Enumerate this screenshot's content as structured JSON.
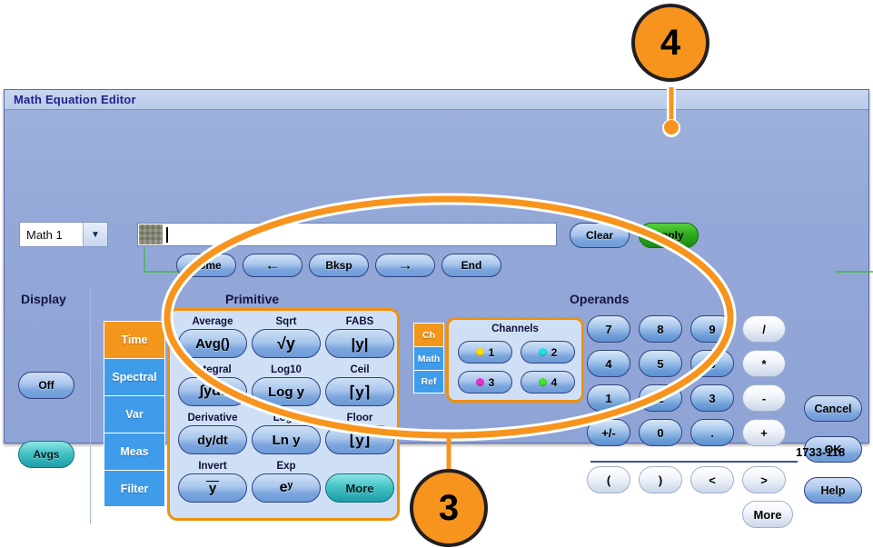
{
  "window": {
    "title": "Math Equation Editor"
  },
  "toolbar": {
    "source_select": {
      "value": "Math 1",
      "arrow_icon": "chevron-down-icon"
    },
    "equation_field": {
      "value": "",
      "placeholder": "",
      "keypad_icon": "grid-keypad-icon"
    },
    "nav_buttons": [
      {
        "label": "Home",
        "name": "home-button"
      },
      {
        "label": "←",
        "name": "left-arrow-button"
      },
      {
        "label": "Bksp",
        "name": "bksp-button"
      },
      {
        "label": "→",
        "name": "right-arrow-button"
      },
      {
        "label": "End",
        "name": "end-button"
      }
    ],
    "clear_label": "Clear",
    "apply_label": "Apply"
  },
  "display": {
    "section_label": "Display",
    "off_label": "Off",
    "avgs_label": "Avgs"
  },
  "categories": {
    "tabs": [
      {
        "label": "Time",
        "active": true
      },
      {
        "label": "Spectral",
        "active": false
      },
      {
        "label": "Var",
        "active": false
      },
      {
        "label": "Meas",
        "active": false
      },
      {
        "label": "Filter",
        "active": false
      }
    ]
  },
  "primitive": {
    "section_label": "Primitive",
    "items": [
      {
        "label": "Average",
        "symbol": "Avg()"
      },
      {
        "label": "Sqrt",
        "symbol": "√y"
      },
      {
        "label": "FABS",
        "symbol": "|y|"
      },
      {
        "label": "Integral",
        "symbol": "∫ydt"
      },
      {
        "label": "Log10",
        "symbol": "Log y"
      },
      {
        "label": "Ceil",
        "symbol": "⌈y⌉"
      },
      {
        "label": "Derivative",
        "symbol": "dy/dt"
      },
      {
        "label": "LogE",
        "symbol": "Ln y"
      },
      {
        "label": "Floor",
        "symbol": "⌊y⌋"
      },
      {
        "label": "Invert",
        "symbol": "y"
      },
      {
        "label": "Exp",
        "symbol": "eʸ"
      },
      {
        "label": "",
        "symbol": "More"
      }
    ]
  },
  "operands": {
    "section_label": "Operands",
    "source_tabs": [
      {
        "label": "Ch",
        "active": true
      },
      {
        "label": "Math",
        "active": false
      },
      {
        "label": "Ref",
        "active": false
      }
    ],
    "channels_title": "Channels",
    "channels": [
      {
        "label": "1",
        "color": "#ffe000"
      },
      {
        "label": "2",
        "color": "#20e0e8"
      },
      {
        "label": "3",
        "color": "#e830c8"
      },
      {
        "label": "4",
        "color": "#49e030"
      }
    ]
  },
  "keypad": {
    "keys": [
      {
        "label": "7",
        "style": "num"
      },
      {
        "label": "8",
        "style": "num"
      },
      {
        "label": "9",
        "style": "num"
      },
      {
        "label": "/",
        "style": "lite"
      },
      {
        "label": "4",
        "style": "num"
      },
      {
        "label": "5",
        "style": "num"
      },
      {
        "label": "6",
        "style": "num"
      },
      {
        "label": "*",
        "style": "lite"
      },
      {
        "label": "1",
        "style": "num"
      },
      {
        "label": "2",
        "style": "num"
      },
      {
        "label": "3",
        "style": "num"
      },
      {
        "label": "-",
        "style": "lite"
      },
      {
        "label": "+/-",
        "style": "num"
      },
      {
        "label": "0",
        "style": "num"
      },
      {
        "label": ".",
        "style": "num"
      },
      {
        "label": "+",
        "style": "lite"
      }
    ],
    "extra_keys": [
      {
        "label": "(",
        "style": "lite"
      },
      {
        "label": ")",
        "style": "lite"
      },
      {
        "label": "<",
        "style": "lite"
      },
      {
        "label": ">",
        "style": "lite"
      }
    ],
    "more_label": "More"
  },
  "actions": {
    "cancel_label": "Cancel",
    "ok_label": "OK",
    "help_label": "Help"
  },
  "annotations": {
    "callout_3": "3",
    "callout_4": "4",
    "reference_number": "1733-118",
    "highlight_color": "#f7941d"
  }
}
